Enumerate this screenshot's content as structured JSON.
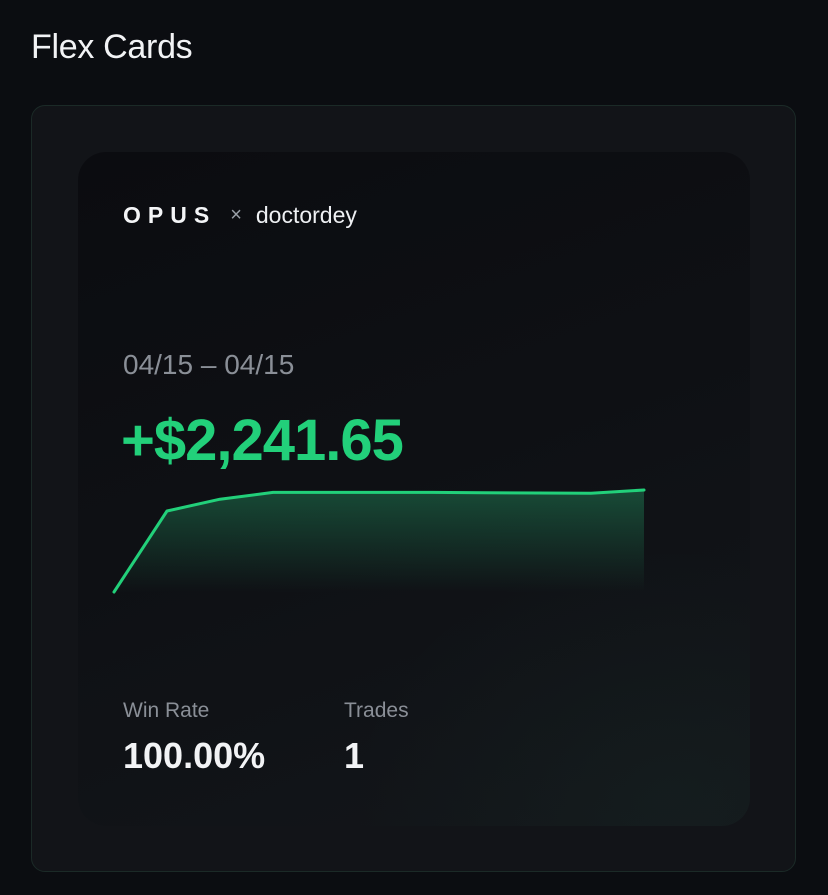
{
  "page": {
    "title": "Flex Cards"
  },
  "card": {
    "brand": "OPUS",
    "separator": "×",
    "username": "doctordey",
    "date_range": "04/15 – 04/15",
    "pnl": "+$2,241.65",
    "accent_color": "#22d07a",
    "stats": {
      "win_rate_label": "Win Rate",
      "win_rate_value": "100.00%",
      "trades_label": "Trades",
      "trades_value": "1"
    }
  },
  "chart_data": {
    "type": "area",
    "title": "",
    "xlabel": "",
    "ylabel": "",
    "grid": false,
    "series": [
      {
        "values": [
          0,
          1780,
          2040,
          2190,
          2190,
          2190,
          2190,
          2180,
          2175,
          2170,
          2241.65
        ]
      }
    ],
    "ylim": [
      0,
      2241.65
    ]
  }
}
